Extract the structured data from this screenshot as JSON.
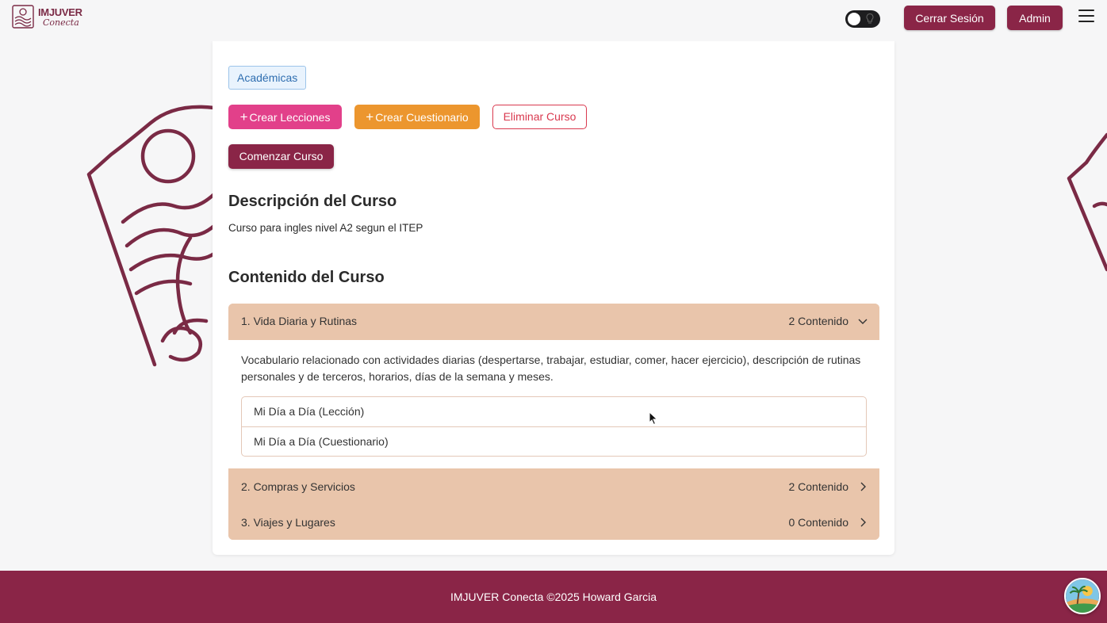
{
  "header": {
    "logo_title": "IMJUVER",
    "logo_subtitle": "Conecta",
    "logout_label": "Cerrar Sesión",
    "admin_label": "Admin"
  },
  "course": {
    "category_tag": "Académicas",
    "create_lessons_label": "Crear Lecciones",
    "create_quiz_label": "Crear Cuestionario",
    "delete_course_label": "Eliminar Curso",
    "start_course_label": "Comenzar Curso",
    "description_heading": "Descripción del Curso",
    "description_text": "Curso para ingles nivel A2 segun el ITEP",
    "content_heading": "Contenido del Curso",
    "modules": [
      {
        "title": "1. Vida Diaria y Rutinas",
        "count": "2 Contenido",
        "expanded": true,
        "description": "Vocabulario relacionado con actividades diarias (despertarse, trabajar, estudiar, comer, hacer ejercicio), descripción de rutinas personales y de terceros, horarios, días de la semana y meses.",
        "items": [
          "Mi Día a Día (Lección)",
          "Mi Día a Día (Cuestionario)"
        ]
      },
      {
        "title": "2. Compras y Servicios",
        "count": "2 Contenido",
        "expanded": false
      },
      {
        "title": "3. Viajes y Lugares",
        "count": "0 Contenido",
        "expanded": false
      }
    ]
  },
  "footer": {
    "text": "IMJUVER Conecta ©2025 Howard Garcia"
  },
  "colors": {
    "brand": "#8a2547",
    "lessons": "#e2408a",
    "quiz": "#ec962e",
    "danger": "#d9394f",
    "accordion": "#e9c5ab"
  },
  "icons": [
    "logo-icon",
    "theme-toggle-icon",
    "menu-icon",
    "plus-icon",
    "chevron-down-icon",
    "chevron-right-icon",
    "chat-avatar-icon"
  ]
}
